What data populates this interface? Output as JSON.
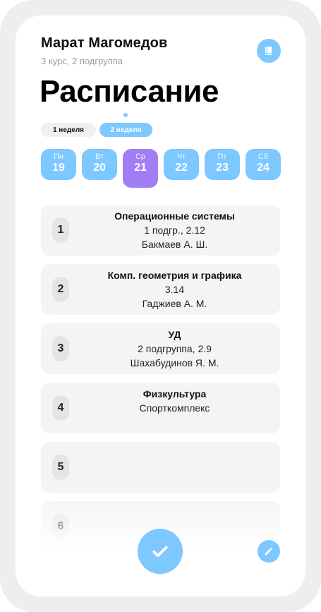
{
  "header": {
    "user_name": "Марат Магомедов",
    "user_subtitle": "3 курс, 2 подгруппа",
    "title": "Расписание"
  },
  "weeks": [
    "1 неделя",
    "2 неделя"
  ],
  "days": [
    {
      "dow": "Пн",
      "num": "19"
    },
    {
      "dow": "Вт",
      "num": "20"
    },
    {
      "dow": "Ср",
      "num": "21"
    },
    {
      "dow": "Чт",
      "num": "22"
    },
    {
      "dow": "Пт",
      "num": "23"
    },
    {
      "dow": "Сб",
      "num": "24"
    }
  ],
  "lessons": [
    {
      "num": "1",
      "subject": "Операционные системы",
      "room": "1 подгр., 2.12",
      "teacher": "Бакмаев А. Ш."
    },
    {
      "num": "2",
      "subject": "Комп. геометрия и графика",
      "room": "3.14",
      "teacher": "Гаджиев А. М."
    },
    {
      "num": "3",
      "subject": "УД",
      "room": "2 подгруппа, 2.9",
      "teacher": "Шахабудинов Я. М."
    },
    {
      "num": "4",
      "subject": "Физкультура",
      "room": "Спорткомплекс",
      "teacher": ""
    },
    {
      "num": "5",
      "subject": "",
      "room": "",
      "teacher": ""
    },
    {
      "num": "6",
      "subject": "",
      "room": "",
      "teacher": ""
    }
  ],
  "icons": {
    "book": "book-icon",
    "confirm": "check-icon",
    "edit": "pencil-icon"
  },
  "colors": {
    "accent": "#7cc8ff",
    "active_day": "#a17ef5",
    "card": "#f4f4f4"
  }
}
